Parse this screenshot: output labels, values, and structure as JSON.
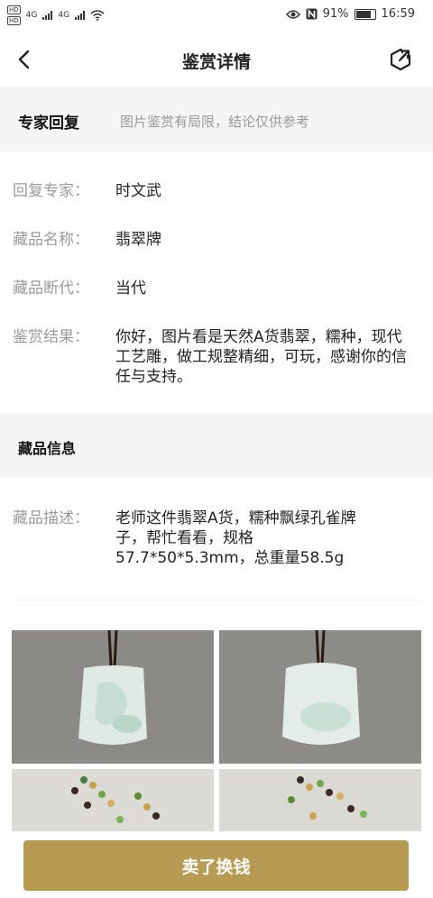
{
  "status_bar": {
    "hd": "HD",
    "net": "4G",
    "battery": "91%",
    "battery_level": 0.91,
    "time": "16:59",
    "icons": [
      "hd-icon",
      "signal-icon",
      "wifi-icon",
      "eye-icon",
      "nfc-icon",
      "battery-icon"
    ]
  },
  "nav": {
    "title": "鉴赏详情",
    "back_icon": "chevron-left-icon",
    "share_icon": "share-icon"
  },
  "expert_reply": {
    "heading": "专家回复",
    "note": "图片鉴赏有局限，结论仅供参考",
    "rows": [
      {
        "label": "回复专家：",
        "value": "时文武"
      },
      {
        "label": "藏品名称：",
        "value": "翡翠牌"
      },
      {
        "label": "藏品断代：",
        "value": "当代"
      },
      {
        "label": "鉴赏结果：",
        "value": "你好，图片看是天然A货翡翠，糯种，现代工艺雕，做工规整精细，可玩，感谢你的信任与支持。"
      }
    ]
  },
  "collection_info": {
    "heading": "藏品信息",
    "rows": [
      {
        "label": "藏品描述：",
        "value": "老师这件翡翠A货，糯种飘绿孔雀牌子，帮忙看看，规格57.7*50*5.3mm，总重量58.5g"
      }
    ]
  },
  "photos": [
    "jade-pendant-front-photo",
    "jade-pendant-back-photo",
    "bead-cord-photo",
    "bead-cord-detail-photo"
  ],
  "colors": {
    "accent": "#b89b52",
    "section_bg": "#f5f5f5",
    "label": "#9a9a9a"
  },
  "footer": {
    "sell_button": "卖了换钱"
  }
}
